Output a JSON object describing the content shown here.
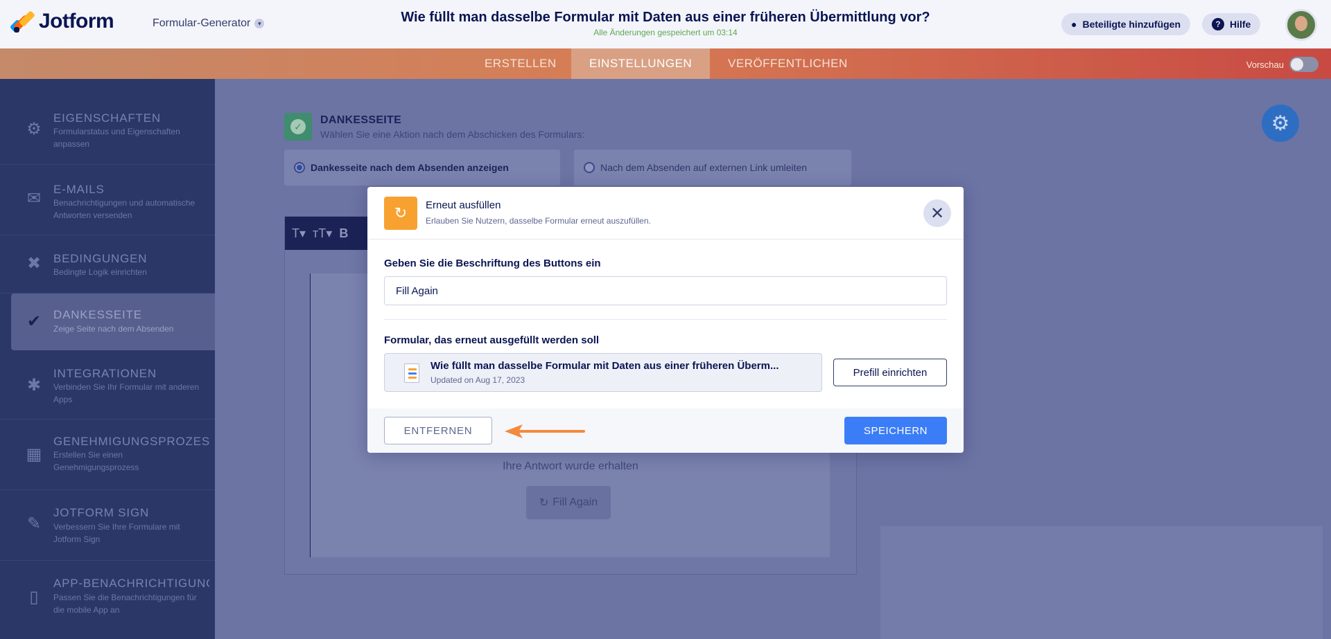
{
  "header": {
    "logo_text": "Jotform",
    "builder_label": "Formular-Generator",
    "page_title": "Wie füllt man dasselbe Formular mit Daten aus einer früheren Übermittlung vor?",
    "save_status": "Alle Änderungen gespeichert um 03:14",
    "add_participants": "Beteiligte hinzufügen",
    "help": "Hilfe"
  },
  "nav": {
    "tabs": [
      {
        "label": "ERSTELLEN"
      },
      {
        "label": "EINSTELLUNGEN"
      },
      {
        "label": "VERÖFFENTLICHEN"
      }
    ],
    "preview_label": "Vorschau"
  },
  "sidebar": {
    "items": [
      {
        "title": "EIGENSCHAFTEN",
        "desc": "Formularstatus und Eigenschaften anpassen",
        "icon": "gear-icon"
      },
      {
        "title": "E-MAILS",
        "desc": "Benachrichtigungen und automatische Antworten versenden",
        "icon": "envelope-icon"
      },
      {
        "title": "BEDINGUNGEN",
        "desc": "Bedingte Logik einrichten",
        "icon": "shuffle-icon"
      },
      {
        "title": "DANKESSEITE",
        "desc": "Zeige Seite nach dem Absenden",
        "icon": "check-circle-icon"
      },
      {
        "title": "INTEGRATIONEN",
        "desc": "Verbinden Sie Ihr Formular mit anderen Apps",
        "icon": "puzzle-icon"
      },
      {
        "title": "GENEHMIGUNGSPROZES...",
        "desc": "Erstellen Sie einen Genehmigungsprozess",
        "icon": "flow-icon"
      },
      {
        "title": "JOTFORM SIGN",
        "desc": "Verbessern Sie Ihre Formulare mit Jotform Sign",
        "icon": "pen-icon"
      },
      {
        "title": "APP-BENACHRICHTIGUNG",
        "desc": "Passen Sie die Benachrichtigungen für die mobile App an",
        "icon": "mobile-icon"
      }
    ]
  },
  "thankyou": {
    "title": "DANKESSEITE",
    "subtitle": "Wählen Sie eine Aktion nach dem Abschicken des Formulars:",
    "option_show": "Dankesseite nach dem Absenden anzeigen",
    "option_redirect": "Nach dem Absenden auf externen Link umleiten",
    "received_text": "Ihre Antwort wurde erhalten",
    "fill_again_btn": "Fill Again"
  },
  "modal": {
    "title": "Erneut ausfüllen",
    "subtitle": "Erlauben Sie Nutzern, dasselbe Formular erneut auszufüllen.",
    "button_label_heading": "Geben Sie die Beschriftung des Buttons ein",
    "button_label_value": "Fill Again",
    "form_heading": "Formular, das erneut ausgefüllt werden soll",
    "form_title": "Wie füllt man dasselbe Formular mit Daten aus einer früheren Überm...",
    "form_updated": "Updated on Aug 17, 2023",
    "prefill_btn": "Prefill einrichten",
    "remove_btn": "ENTFERNEN",
    "save_btn": "SPEICHERN"
  },
  "colors": {
    "accent_orange": "#f7a230",
    "save_blue": "#3b7df7",
    "sidebar_bg": "#2b3767",
    "arrow": "#f58a3c"
  }
}
